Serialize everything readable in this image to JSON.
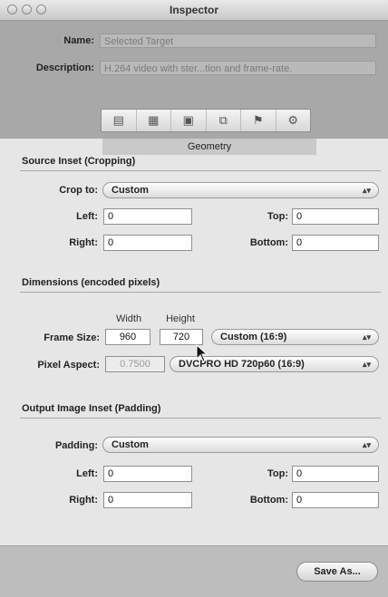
{
  "window": {
    "title": "Inspector"
  },
  "header": {
    "name_label": "Name:",
    "name_value": "Selected Target",
    "description_label": "Description:",
    "description_value": "H.264 video with ster...tion and frame-rate.",
    "toolbar_icons": [
      "summary-icon",
      "video-icon",
      "filters-icon",
      "geometry-icon",
      "actions-icon",
      "settings-icon"
    ],
    "active_tab": "Geometry"
  },
  "source_inset": {
    "title": "Source Inset (Cropping)",
    "crop_label": "Crop to:",
    "crop_value": "Custom",
    "left_label": "Left:",
    "left_value": "0",
    "top_label": "Top:",
    "top_value": "0",
    "right_label": "Right:",
    "right_value": "0",
    "bottom_label": "Bottom:",
    "bottom_value": "0"
  },
  "dimensions": {
    "title": "Dimensions (encoded pixels)",
    "width_header": "Width",
    "height_header": "Height",
    "frame_size_label": "Frame Size:",
    "width_value": "960",
    "height_value": "720",
    "frame_preset": "Custom (16:9)",
    "pixel_aspect_label": "Pixel Aspect:",
    "pixel_aspect_value": "0.7500",
    "pixel_aspect_preset": "DVCPRO HD 720p60 (16:9)"
  },
  "output_inset": {
    "title": "Output Image Inset (Padding)",
    "padding_label": "Padding:",
    "padding_value": "Custom",
    "left_label": "Left:",
    "left_value": "0",
    "top_label": "Top:",
    "top_value": "0",
    "right_label": "Right:",
    "right_value": "0",
    "bottom_label": "Bottom:",
    "bottom_value": "0"
  },
  "footer": {
    "save_as_label": "Save As..."
  },
  "colors": {
    "header_bg": "#a8a8a8",
    "panel_bg": "#e6e6e6"
  }
}
